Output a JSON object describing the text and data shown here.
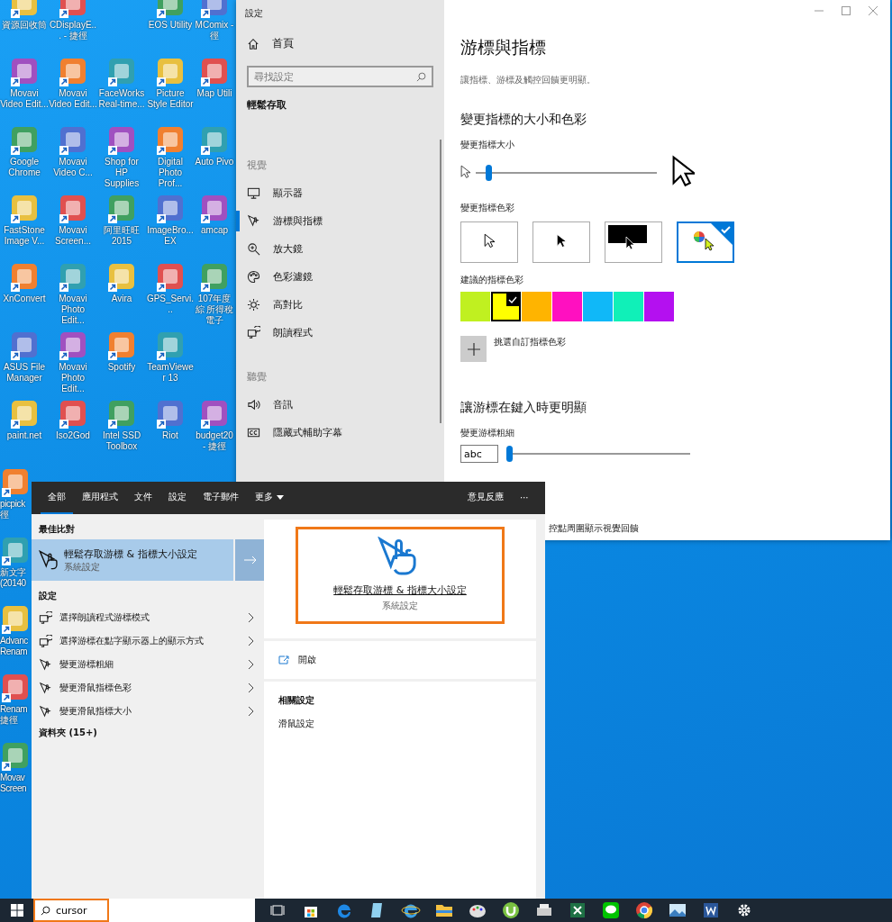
{
  "desktop": {
    "rows": [
      [
        {
          "label": "資源回收筒"
        },
        {
          "label": "CDisplayE... - 捷徑"
        },
        {},
        {
          "label": "EOS Utility"
        },
        {
          "label": "MComix - 徑"
        }
      ],
      [
        {
          "label": "Movavi Video Edit..."
        },
        {
          "label": "Movavi Video Edit..."
        },
        {
          "label": "FaceWorks Real-time..."
        },
        {
          "label": "Picture Style Editor"
        },
        {
          "label": "Map Utili"
        }
      ],
      [
        {
          "label": "Google Chrome"
        },
        {
          "label": "Movavi Video C..."
        },
        {
          "label": "Shop for HP Supplies"
        },
        {
          "label": "Digital Photo Prof..."
        },
        {
          "label": "Auto Pivo"
        }
      ],
      [
        {
          "label": "FastStone Image V..."
        },
        {
          "label": "Movavi Screen..."
        },
        {
          "label": "阿里旺旺 2015"
        },
        {
          "label": "ImageBro... EX"
        },
        {
          "label": "amcap"
        }
      ],
      [
        {
          "label": "XnConvert"
        },
        {
          "label": "Movavi Photo Edit..."
        },
        {
          "label": "Avira"
        },
        {
          "label": "GPS_Servi..."
        },
        {
          "label": "107年度綜 所得稅電子"
        }
      ],
      [
        {
          "label": "ASUS File Manager"
        },
        {
          "label": "Movavi Photo Edit..."
        },
        {
          "label": "Spotify"
        },
        {
          "label": "TeamViewer 13"
        }
      ],
      [
        {
          "label": "paint.net"
        },
        {
          "label": "Iso2God"
        },
        {
          "label": "Intel SSD Toolbox"
        },
        {
          "label": "Riot"
        },
        {
          "label": "budget20 - 捷徑"
        }
      ],
      [
        {
          "label": "picpick 徑"
        }
      ],
      [
        {
          "label": "新文字 (20140"
        }
      ],
      [
        {
          "label": "Advanc Renam"
        }
      ],
      [
        {
          "label": "Renam 捷徑"
        }
      ],
      [
        {
          "label": "Movav Screen"
        }
      ]
    ]
  },
  "settings": {
    "title": "設定",
    "nav": {
      "home": "首頁",
      "search_placeholder": "尋找設定",
      "section": "輕鬆存取",
      "groups": [
        {
          "label": "視覺",
          "items": [
            {
              "label": "顯示器",
              "kind": "monitor",
              "selected": false
            },
            {
              "label": "游標與指標",
              "kind": "cursor",
              "selected": true
            },
            {
              "label": "放大鏡",
              "kind": "magnifier",
              "selected": false
            },
            {
              "label": "色彩濾鏡",
              "kind": "palette",
              "selected": false
            },
            {
              "label": "高對比",
              "kind": "sun",
              "selected": false
            },
            {
              "label": "朗讀程式",
              "kind": "narrator",
              "selected": false
            }
          ]
        },
        {
          "label": "聽覺",
          "items": [
            {
              "label": "音訊",
              "kind": "speaker",
              "selected": false
            },
            {
              "label": "隱藏式輔助字幕",
              "kind": "captions",
              "selected": false
            }
          ]
        }
      ]
    },
    "page": {
      "title": "游標與指標",
      "description": "讓指標、游標及觸控回饋更明顯。",
      "size_color": {
        "heading": "變更指標的大小和色彩",
        "size_label": "變更指標大小",
        "size_slider": {
          "level": 0.07
        },
        "color_label": "變更指標色彩",
        "color_options": [
          {
            "kind": "white",
            "selected": false
          },
          {
            "kind": "black",
            "selected": false
          },
          {
            "kind": "inverted",
            "selected": false
          },
          {
            "kind": "custom",
            "selected": true
          }
        ],
        "suggested_label": "建議的指標色彩",
        "swatches": [
          {
            "color": "#c0f020",
            "selected": false
          },
          {
            "color": "#ffff00",
            "selected": true
          },
          {
            "color": "#ffb400",
            "selected": false
          },
          {
            "color": "#ff10c0",
            "selected": false
          },
          {
            "color": "#10b8f8",
            "selected": false
          },
          {
            "color": "#10f0b8",
            "selected": false
          },
          {
            "color": "#b410f0",
            "selected": false
          }
        ],
        "custom_button": "挑選自訂指標色彩"
      },
      "typing": {
        "heading": "讓游標在鍵入時更明顯",
        "thickness_label": "變更游標粗細",
        "preview": "abc",
        "thickness_slider": {
          "level": 0.01
        }
      },
      "partial_text": "控點周圍顯示視覺回饋"
    }
  },
  "search": {
    "tabs": [
      {
        "label": "全部",
        "selected": true
      },
      {
        "label": "應用程式",
        "selected": false
      },
      {
        "label": "文件",
        "selected": false
      },
      {
        "label": "設定",
        "selected": false
      },
      {
        "label": "電子郵件",
        "selected": false
      },
      {
        "label": "更多",
        "selected": false,
        "caret": true
      }
    ],
    "feedback": "意見反應",
    "more": "⋯",
    "best_match_header": "最佳比對",
    "best_match": {
      "title": "輕鬆存取游標 & 指標大小設定",
      "subtitle": "系統設定",
      "selected": true
    },
    "settings_header": "設定",
    "results": [
      {
        "label": "選擇朗讀程式游標模式",
        "kind": "narrator"
      },
      {
        "label": "選擇游標在點字顯示器上的顯示方式",
        "kind": "narrator"
      },
      {
        "label": "變更游標粗細",
        "kind": "cursor"
      },
      {
        "label": "變更滑鼠指標色彩",
        "kind": "cursor"
      },
      {
        "label": "變更滑鼠指標大小",
        "kind": "cursor"
      }
    ],
    "folders": "資料夾 (15+)",
    "preview": {
      "title": "輕鬆存取游標 & 指標大小設定",
      "subtitle": "系統設定",
      "highlighted": true
    },
    "open": "開啟",
    "related_header": "相關設定",
    "related": [
      "滑鼠設定"
    ]
  },
  "taskbar": {
    "search_value": "cursor",
    "search_highlighted": true
  }
}
